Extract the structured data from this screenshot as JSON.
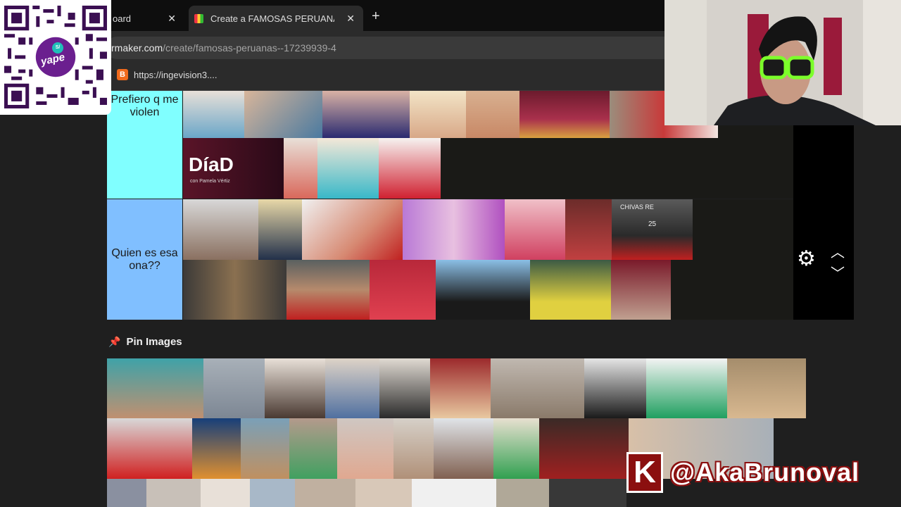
{
  "browser": {
    "tabs": [
      {
        "label": "oard",
        "active": false
      },
      {
        "label": "Create a FAMOSAS PERUANAS",
        "active": true
      }
    ],
    "close_glyph": "✕",
    "new_tab_glyph": "+",
    "url_host": "rmaker.com",
    "url_path": "/create/famosas-peruanas--17239939-4",
    "bookmark_label": "https://ingevision3...."
  },
  "tiers": [
    {
      "label": "Prefiero q me violen",
      "color": "#80ffff"
    },
    {
      "label": "Quien es esa ona??",
      "color": "#80bfff"
    }
  ],
  "tier_images": {
    "tier1": [
      "#6aa6c8",
      "#d8b59a",
      "#c9b2b5",
      "#e8d1b6",
      "#d8a888",
      "#a9304c",
      "#9b8d7c",
      "#6c1b2d",
      "#c3a283",
      "#d9685b",
      "#f2e6e2"
    ],
    "tier2": [
      "#c7c7c7",
      "#9aa0b6",
      "#d78a73",
      "#b979d6",
      "#e6c6c6",
      "#6c2c2a",
      "#5a5a5a",
      "#3c3a38",
      "#b68a6c",
      "#b8283a",
      "#8bbfe6",
      "#3c5a44",
      "#7a1a2a"
    ]
  },
  "chivas_text": "CHIVAS RE",
  "chivas_number": "25",
  "diad_title": "DíaD",
  "diad_sub": "con Pamela Vértiz",
  "controls": {
    "gear_icon": "gear-icon",
    "up_icon": "chevron-up-icon",
    "down_icon": "chevron-down-icon"
  },
  "pin_section": {
    "title": "Pin Images"
  },
  "pin_images_row1": [
    "#3fa2a8",
    "#7d8794",
    "#c7c1bb",
    "#ded3c7",
    "#c8c2b9",
    "#9c2a2c",
    "#c0b8b0",
    "#e5e5e5",
    "#f3f3f3",
    "#a58d6c"
  ],
  "pin_images_row2": [
    "#d8d8d8",
    "#173f7a",
    "#7aa0b8",
    "#b49a8c",
    "#cfc7c2",
    "#d6d0c8",
    "#e0e4e8",
    "#3a2a26",
    "#d8c0a8",
    "#a8b0b8"
  ],
  "pin_images_row3": [
    "#8a90a0",
    "#c8c0b8",
    "#e8e0d8",
    "#a8b8c8",
    "#c0b0a0",
    "#d8c8b8",
    "#f0f0f0",
    "#b0a898",
    "#383838",
    "#d0c0b0"
  ],
  "overlay": {
    "yape_text": "yape",
    "yape_badge": "S/",
    "brand_letter": "K",
    "handle": "@AkaBrunoval"
  }
}
